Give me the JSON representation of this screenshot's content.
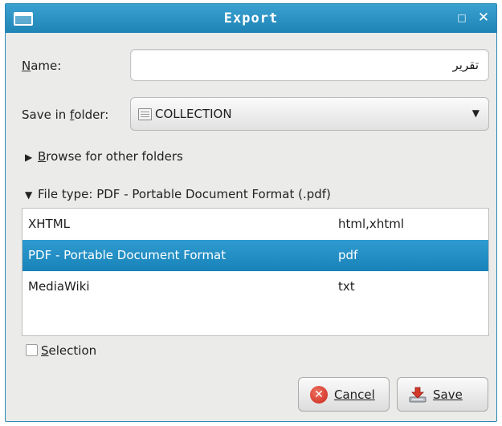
{
  "window": {
    "title": "Export",
    "maximize_glyph": "□",
    "close_glyph": "✕"
  },
  "name_field": {
    "label_mnemonic": "N",
    "label_rest": "ame:",
    "value": "تقرير"
  },
  "save_in": {
    "label_prefix": "Save in ",
    "label_mnemonic": "f",
    "label_rest": "older:",
    "value": "COLLECTION",
    "icon": "folder-icon",
    "arrow_glyph": "▼"
  },
  "browse": {
    "triangle": "▶",
    "label_mnemonic": "B",
    "label_rest": "rowse for other folders"
  },
  "file_type": {
    "triangle": "▼",
    "label": "File type: PDF - Portable Document Format (.pdf)"
  },
  "file_types": [
    {
      "name": "XHTML",
      "ext": "html,xhtml"
    },
    {
      "name": "PDF - Portable Document Format",
      "ext": "pdf"
    },
    {
      "name": "MediaWiki",
      "ext": "txt"
    }
  ],
  "selected_index": 1,
  "selection_checkbox": {
    "label_mnemonic": "S",
    "label_rest": "election",
    "checked": false
  },
  "buttons": {
    "cancel_label": "Cancel",
    "save_label": "Save"
  },
  "colors": {
    "accent": "#1e84b6",
    "selection": "#1883b8",
    "cancel_icon": "#c8281c",
    "save_icon": "#d63a2a"
  }
}
